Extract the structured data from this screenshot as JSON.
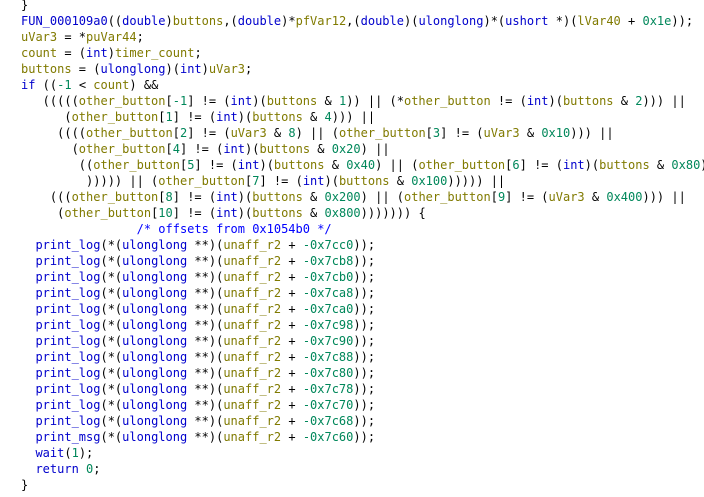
{
  "colors": {
    "function": "#0000cc",
    "variable": "#807a00",
    "keyword": "#0000cc",
    "type": "#0000cc",
    "number": "#00875a",
    "comment": "#0000ff",
    "plain": "#000000"
  },
  "lines": [
    [
      {
        "t": "}",
        "c": "op"
      }
    ],
    [
      {
        "t": "FUN_000109a0",
        "c": "fn"
      },
      {
        "t": "((",
        "c": "op"
      },
      {
        "t": "double",
        "c": "ty"
      },
      {
        "t": ")",
        "c": "op"
      },
      {
        "t": "buttons",
        "c": "var"
      },
      {
        "t": ",(",
        "c": "op"
      },
      {
        "t": "double",
        "c": "ty"
      },
      {
        "t": ")*",
        "c": "op"
      },
      {
        "t": "pfVar12",
        "c": "var"
      },
      {
        "t": ",(",
        "c": "op"
      },
      {
        "t": "double",
        "c": "ty"
      },
      {
        "t": ")(",
        "c": "op"
      },
      {
        "t": "ulonglong",
        "c": "ty"
      },
      {
        "t": ")*(",
        "c": "op"
      },
      {
        "t": "ushort",
        "c": "ty"
      },
      {
        "t": " *)(",
        "c": "op"
      },
      {
        "t": "lVar40",
        "c": "var"
      },
      {
        "t": " + ",
        "c": "op"
      },
      {
        "t": "0x1e",
        "c": "num"
      },
      {
        "t": "));",
        "c": "op"
      }
    ],
    [
      {
        "t": "uVar3",
        "c": "var"
      },
      {
        "t": " = *",
        "c": "op"
      },
      {
        "t": "puVar44",
        "c": "var"
      },
      {
        "t": ";",
        "c": "op"
      }
    ],
    [
      {
        "t": "count",
        "c": "var"
      },
      {
        "t": " = (",
        "c": "op"
      },
      {
        "t": "int",
        "c": "ty"
      },
      {
        "t": ")",
        "c": "op"
      },
      {
        "t": "timer_count",
        "c": "var"
      },
      {
        "t": ";",
        "c": "op"
      }
    ],
    [
      {
        "t": "buttons",
        "c": "var"
      },
      {
        "t": " = (",
        "c": "op"
      },
      {
        "t": "ulonglong",
        "c": "ty"
      },
      {
        "t": ")(",
        "c": "op"
      },
      {
        "t": "int",
        "c": "ty"
      },
      {
        "t": ")",
        "c": "op"
      },
      {
        "t": "uVar3",
        "c": "var"
      },
      {
        "t": ";",
        "c": "op"
      }
    ],
    [
      {
        "t": "if",
        "c": "kw"
      },
      {
        "t": " ((",
        "c": "op"
      },
      {
        "t": "-1",
        "c": "num"
      },
      {
        "t": " < ",
        "c": "op"
      },
      {
        "t": "count",
        "c": "var"
      },
      {
        "t": ") &&",
        "c": "op"
      }
    ],
    [
      {
        "t": "   (((((",
        "c": "op"
      },
      {
        "t": "other_button",
        "c": "var"
      },
      {
        "t": "[",
        "c": "op"
      },
      {
        "t": "-1",
        "c": "num"
      },
      {
        "t": "] != (",
        "c": "op"
      },
      {
        "t": "int",
        "c": "ty"
      },
      {
        "t": ")(",
        "c": "op"
      },
      {
        "t": "buttons",
        "c": "var"
      },
      {
        "t": " & ",
        "c": "op"
      },
      {
        "t": "1",
        "c": "num"
      },
      {
        "t": ")) || (*",
        "c": "op"
      },
      {
        "t": "other_button",
        "c": "var"
      },
      {
        "t": " != (",
        "c": "op"
      },
      {
        "t": "int",
        "c": "ty"
      },
      {
        "t": ")(",
        "c": "op"
      },
      {
        "t": "buttons",
        "c": "var"
      },
      {
        "t": " & ",
        "c": "op"
      },
      {
        "t": "2",
        "c": "num"
      },
      {
        "t": "))) ||",
        "c": "op"
      }
    ],
    [
      {
        "t": "      (",
        "c": "op"
      },
      {
        "t": "other_button",
        "c": "var"
      },
      {
        "t": "[",
        "c": "op"
      },
      {
        "t": "1",
        "c": "num"
      },
      {
        "t": "] != (",
        "c": "op"
      },
      {
        "t": "int",
        "c": "ty"
      },
      {
        "t": ")(",
        "c": "op"
      },
      {
        "t": "buttons",
        "c": "var"
      },
      {
        "t": " & ",
        "c": "op"
      },
      {
        "t": "4",
        "c": "num"
      },
      {
        "t": "))) ||",
        "c": "op"
      }
    ],
    [
      {
        "t": "     ((((",
        "c": "op"
      },
      {
        "t": "other_button",
        "c": "var"
      },
      {
        "t": "[",
        "c": "op"
      },
      {
        "t": "2",
        "c": "num"
      },
      {
        "t": "] != (",
        "c": "op"
      },
      {
        "t": "uVar3",
        "c": "var"
      },
      {
        "t": " & ",
        "c": "op"
      },
      {
        "t": "8",
        "c": "num"
      },
      {
        "t": ") || (",
        "c": "op"
      },
      {
        "t": "other_button",
        "c": "var"
      },
      {
        "t": "[",
        "c": "op"
      },
      {
        "t": "3",
        "c": "num"
      },
      {
        "t": "] != (",
        "c": "op"
      },
      {
        "t": "uVar3",
        "c": "var"
      },
      {
        "t": " & ",
        "c": "op"
      },
      {
        "t": "0x10",
        "c": "num"
      },
      {
        "t": "))) ||",
        "c": "op"
      }
    ],
    [
      {
        "t": "       (",
        "c": "op"
      },
      {
        "t": "other_button",
        "c": "var"
      },
      {
        "t": "[",
        "c": "op"
      },
      {
        "t": "4",
        "c": "num"
      },
      {
        "t": "] != (",
        "c": "op"
      },
      {
        "t": "int",
        "c": "ty"
      },
      {
        "t": ")(",
        "c": "op"
      },
      {
        "t": "buttons",
        "c": "var"
      },
      {
        "t": " & ",
        "c": "op"
      },
      {
        "t": "0x20",
        "c": "num"
      },
      {
        "t": ") ||",
        "c": "op"
      }
    ],
    [
      {
        "t": "        ((",
        "c": "op"
      },
      {
        "t": "other_button",
        "c": "var"
      },
      {
        "t": "[",
        "c": "op"
      },
      {
        "t": "5",
        "c": "num"
      },
      {
        "t": "] != (",
        "c": "op"
      },
      {
        "t": "int",
        "c": "ty"
      },
      {
        "t": ")(",
        "c": "op"
      },
      {
        "t": "buttons",
        "c": "var"
      },
      {
        "t": " & ",
        "c": "op"
      },
      {
        "t": "0x40",
        "c": "num"
      },
      {
        "t": ") || (",
        "c": "op"
      },
      {
        "t": "other_button",
        "c": "var"
      },
      {
        "t": "[",
        "c": "op"
      },
      {
        "t": "6",
        "c": "num"
      },
      {
        "t": "] != (",
        "c": "op"
      },
      {
        "t": "int",
        "c": "ty"
      },
      {
        "t": ")(",
        "c": "op"
      },
      {
        "t": "buttons",
        "c": "var"
      },
      {
        "t": " & ",
        "c": "op"
      },
      {
        "t": "0x80",
        "c": "num"
      },
      {
        "t": "))",
        "c": "op"
      }
    ],
    [
      {
        "t": "         ))))) || (",
        "c": "op"
      },
      {
        "t": "other_button",
        "c": "var"
      },
      {
        "t": "[",
        "c": "op"
      },
      {
        "t": "7",
        "c": "num"
      },
      {
        "t": "] != (",
        "c": "op"
      },
      {
        "t": "int",
        "c": "ty"
      },
      {
        "t": ")(",
        "c": "op"
      },
      {
        "t": "buttons",
        "c": "var"
      },
      {
        "t": " & ",
        "c": "op"
      },
      {
        "t": "0x100",
        "c": "num"
      },
      {
        "t": "))))) ||",
        "c": "op"
      }
    ],
    [
      {
        "t": "    (((",
        "c": "op"
      },
      {
        "t": "other_button",
        "c": "var"
      },
      {
        "t": "[",
        "c": "op"
      },
      {
        "t": "8",
        "c": "num"
      },
      {
        "t": "] != (",
        "c": "op"
      },
      {
        "t": "int",
        "c": "ty"
      },
      {
        "t": ")(",
        "c": "op"
      },
      {
        "t": "buttons",
        "c": "var"
      },
      {
        "t": " & ",
        "c": "op"
      },
      {
        "t": "0x200",
        "c": "num"
      },
      {
        "t": ") || (",
        "c": "op"
      },
      {
        "t": "other_button",
        "c": "var"
      },
      {
        "t": "[",
        "c": "op"
      },
      {
        "t": "9",
        "c": "num"
      },
      {
        "t": "] != (",
        "c": "op"
      },
      {
        "t": "uVar3",
        "c": "var"
      },
      {
        "t": " & ",
        "c": "op"
      },
      {
        "t": "0x400",
        "c": "num"
      },
      {
        "t": "))) ||",
        "c": "op"
      }
    ],
    [
      {
        "t": "     (",
        "c": "op"
      },
      {
        "t": "other_button",
        "c": "var"
      },
      {
        "t": "[",
        "c": "op"
      },
      {
        "t": "10",
        "c": "num"
      },
      {
        "t": "] != (",
        "c": "op"
      },
      {
        "t": "int",
        "c": "ty"
      },
      {
        "t": ")(",
        "c": "op"
      },
      {
        "t": "buttons",
        "c": "var"
      },
      {
        "t": " & ",
        "c": "op"
      },
      {
        "t": "0x800",
        "c": "num"
      },
      {
        "t": "))))))) {",
        "c": "op"
      }
    ],
    [
      {
        "t": "                /* offsets from 0x1054b0 */",
        "c": "cmt"
      }
    ],
    [
      {
        "t": "  ",
        "c": "op"
      },
      {
        "t": "print_log",
        "c": "fn"
      },
      {
        "t": "(*(",
        "c": "op"
      },
      {
        "t": "ulonglong",
        "c": "ty"
      },
      {
        "t": " **)(",
        "c": "op"
      },
      {
        "t": "unaff_r2",
        "c": "var"
      },
      {
        "t": " + ",
        "c": "op"
      },
      {
        "t": "-0x7cc0",
        "c": "num"
      },
      {
        "t": "));",
        "c": "op"
      }
    ],
    [
      {
        "t": "  ",
        "c": "op"
      },
      {
        "t": "print_log",
        "c": "fn"
      },
      {
        "t": "(*(",
        "c": "op"
      },
      {
        "t": "ulonglong",
        "c": "ty"
      },
      {
        "t": " **)(",
        "c": "op"
      },
      {
        "t": "unaff_r2",
        "c": "var"
      },
      {
        "t": " + ",
        "c": "op"
      },
      {
        "t": "-0x7cb8",
        "c": "num"
      },
      {
        "t": "));",
        "c": "op"
      }
    ],
    [
      {
        "t": "  ",
        "c": "op"
      },
      {
        "t": "print_log",
        "c": "fn"
      },
      {
        "t": "(*(",
        "c": "op"
      },
      {
        "t": "ulonglong",
        "c": "ty"
      },
      {
        "t": " **)(",
        "c": "op"
      },
      {
        "t": "unaff_r2",
        "c": "var"
      },
      {
        "t": " + ",
        "c": "op"
      },
      {
        "t": "-0x7cb0",
        "c": "num"
      },
      {
        "t": "));",
        "c": "op"
      }
    ],
    [
      {
        "t": "  ",
        "c": "op"
      },
      {
        "t": "print_log",
        "c": "fn"
      },
      {
        "t": "(*(",
        "c": "op"
      },
      {
        "t": "ulonglong",
        "c": "ty"
      },
      {
        "t": " **)(",
        "c": "op"
      },
      {
        "t": "unaff_r2",
        "c": "var"
      },
      {
        "t": " + ",
        "c": "op"
      },
      {
        "t": "-0x7ca8",
        "c": "num"
      },
      {
        "t": "));",
        "c": "op"
      }
    ],
    [
      {
        "t": "  ",
        "c": "op"
      },
      {
        "t": "print_log",
        "c": "fn"
      },
      {
        "t": "(*(",
        "c": "op"
      },
      {
        "t": "ulonglong",
        "c": "ty"
      },
      {
        "t": " **)(",
        "c": "op"
      },
      {
        "t": "unaff_r2",
        "c": "var"
      },
      {
        "t": " + ",
        "c": "op"
      },
      {
        "t": "-0x7ca0",
        "c": "num"
      },
      {
        "t": "));",
        "c": "op"
      }
    ],
    [
      {
        "t": "  ",
        "c": "op"
      },
      {
        "t": "print_log",
        "c": "fn"
      },
      {
        "t": "(*(",
        "c": "op"
      },
      {
        "t": "ulonglong",
        "c": "ty"
      },
      {
        "t": " **)(",
        "c": "op"
      },
      {
        "t": "unaff_r2",
        "c": "var"
      },
      {
        "t": " + ",
        "c": "op"
      },
      {
        "t": "-0x7c98",
        "c": "num"
      },
      {
        "t": "));",
        "c": "op"
      }
    ],
    [
      {
        "t": "  ",
        "c": "op"
      },
      {
        "t": "print_log",
        "c": "fn"
      },
      {
        "t": "(*(",
        "c": "op"
      },
      {
        "t": "ulonglong",
        "c": "ty"
      },
      {
        "t": " **)(",
        "c": "op"
      },
      {
        "t": "unaff_r2",
        "c": "var"
      },
      {
        "t": " + ",
        "c": "op"
      },
      {
        "t": "-0x7c90",
        "c": "num"
      },
      {
        "t": "));",
        "c": "op"
      }
    ],
    [
      {
        "t": "  ",
        "c": "op"
      },
      {
        "t": "print_log",
        "c": "fn"
      },
      {
        "t": "(*(",
        "c": "op"
      },
      {
        "t": "ulonglong",
        "c": "ty"
      },
      {
        "t": " **)(",
        "c": "op"
      },
      {
        "t": "unaff_r2",
        "c": "var"
      },
      {
        "t": " + ",
        "c": "op"
      },
      {
        "t": "-0x7c88",
        "c": "num"
      },
      {
        "t": "));",
        "c": "op"
      }
    ],
    [
      {
        "t": "  ",
        "c": "op"
      },
      {
        "t": "print_log",
        "c": "fn"
      },
      {
        "t": "(*(",
        "c": "op"
      },
      {
        "t": "ulonglong",
        "c": "ty"
      },
      {
        "t": " **)(",
        "c": "op"
      },
      {
        "t": "unaff_r2",
        "c": "var"
      },
      {
        "t": " + ",
        "c": "op"
      },
      {
        "t": "-0x7c80",
        "c": "num"
      },
      {
        "t": "));",
        "c": "op"
      }
    ],
    [
      {
        "t": "  ",
        "c": "op"
      },
      {
        "t": "print_log",
        "c": "fn"
      },
      {
        "t": "(*(",
        "c": "op"
      },
      {
        "t": "ulonglong",
        "c": "ty"
      },
      {
        "t": " **)(",
        "c": "op"
      },
      {
        "t": "unaff_r2",
        "c": "var"
      },
      {
        "t": " + ",
        "c": "op"
      },
      {
        "t": "-0x7c78",
        "c": "num"
      },
      {
        "t": "));",
        "c": "op"
      }
    ],
    [
      {
        "t": "  ",
        "c": "op"
      },
      {
        "t": "print_log",
        "c": "fn"
      },
      {
        "t": "(*(",
        "c": "op"
      },
      {
        "t": "ulonglong",
        "c": "ty"
      },
      {
        "t": " **)(",
        "c": "op"
      },
      {
        "t": "unaff_r2",
        "c": "var"
      },
      {
        "t": " + ",
        "c": "op"
      },
      {
        "t": "-0x7c70",
        "c": "num"
      },
      {
        "t": "));",
        "c": "op"
      }
    ],
    [
      {
        "t": "  ",
        "c": "op"
      },
      {
        "t": "print_log",
        "c": "fn"
      },
      {
        "t": "(*(",
        "c": "op"
      },
      {
        "t": "ulonglong",
        "c": "ty"
      },
      {
        "t": " **)(",
        "c": "op"
      },
      {
        "t": "unaff_r2",
        "c": "var"
      },
      {
        "t": " + ",
        "c": "op"
      },
      {
        "t": "-0x7c68",
        "c": "num"
      },
      {
        "t": "));",
        "c": "op"
      }
    ],
    [
      {
        "t": "  ",
        "c": "op"
      },
      {
        "t": "print_msg",
        "c": "fn"
      },
      {
        "t": "(*(",
        "c": "op"
      },
      {
        "t": "ulonglong",
        "c": "ty"
      },
      {
        "t": " **)(",
        "c": "op"
      },
      {
        "t": "unaff_r2",
        "c": "var"
      },
      {
        "t": " + ",
        "c": "op"
      },
      {
        "t": "-0x7c60",
        "c": "num"
      },
      {
        "t": "));",
        "c": "op"
      }
    ],
    [
      {
        "t": "  ",
        "c": "op"
      },
      {
        "t": "wait",
        "c": "fn"
      },
      {
        "t": "(",
        "c": "op"
      },
      {
        "t": "1",
        "c": "num"
      },
      {
        "t": ");",
        "c": "op"
      }
    ],
    [
      {
        "t": "  ",
        "c": "op"
      },
      {
        "t": "return",
        "c": "kw"
      },
      {
        "t": " ",
        "c": "op"
      },
      {
        "t": "0",
        "c": "num"
      },
      {
        "t": ";",
        "c": "op"
      }
    ],
    [
      {
        "t": "}",
        "c": "op"
      }
    ]
  ]
}
